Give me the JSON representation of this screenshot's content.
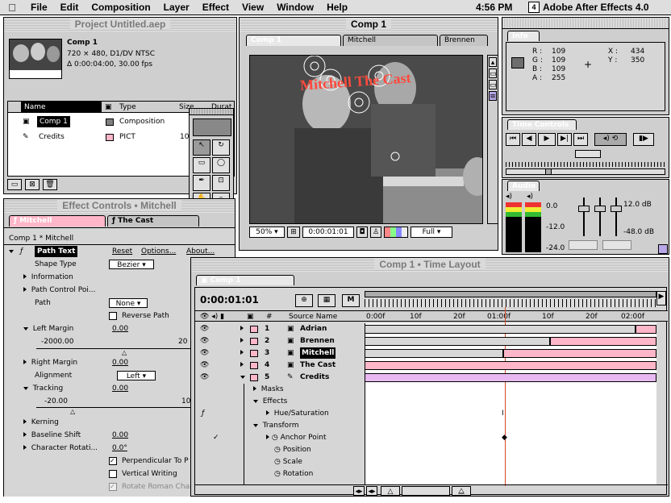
{
  "menubar": {
    "apple": "",
    "items": [
      "File",
      "Edit",
      "Composition",
      "Layer",
      "Effect",
      "View",
      "Window",
      "Help"
    ],
    "clock": "4:56 PM",
    "app_icon_label": "4",
    "app_name": "Adobe After Effects 4.0"
  },
  "project": {
    "title": "Project Untitled.aep",
    "comp_name": "Comp 1",
    "comp_line1": "720 × 480, D1/DV NTSC",
    "comp_line2": "Δ 0:00:04:00, 30.00 fps",
    "columns": [
      "Name",
      "Type",
      "Size",
      "Durat"
    ],
    "items": [
      {
        "name": "Comp 1",
        "type": "Composition",
        "color": "#808080",
        "size": ""
      },
      {
        "name": "Credits",
        "type": "PICT",
        "color": "#ffb6c8",
        "size": "10"
      }
    ]
  },
  "composition": {
    "title": "Comp 1",
    "tabs": [
      "Comp 1",
      "Mitchell",
      "Brennen"
    ],
    "overlay_text": "Mitchell The Cast",
    "zoom": "50%",
    "timecode": "0:00:01:01",
    "resolution": "Full"
  },
  "info": {
    "tab": "Info",
    "r_label": "R :",
    "r": "109",
    "g_label": "G :",
    "g": "109",
    "b_label": "B :",
    "b": "109",
    "a_label": "A :",
    "a": "255",
    "x_label": "X :",
    "x": "434",
    "y_label": "Y :",
    "y": "350",
    "swatch_color": "#6d6d6d"
  },
  "time_controls": {
    "tab": "Time Controls"
  },
  "audio": {
    "tab": "Audio",
    "levels": [
      "0.0",
      "-12.0",
      "-24.0"
    ],
    "right_levels": [
      "12.0 dB",
      "-48.0 dB"
    ]
  },
  "effect_controls": {
    "title": "Effect Controls • Mitchell",
    "tabs": [
      "Mitchell",
      "The Cast"
    ],
    "breadcrumb": "Comp 1 * Mitchell",
    "effect_name": "Path Text",
    "reset": "Reset",
    "options": "Options...",
    "about": "About...",
    "props": [
      {
        "label": "Shape Type",
        "value": "Bezier"
      },
      {
        "label": "Information",
        "value": ""
      },
      {
        "label": "Path Control Poi...",
        "value": ""
      },
      {
        "label": "Path",
        "value": "None"
      },
      {
        "label": "Reverse Path",
        "value": ""
      },
      {
        "label": "Left Margin",
        "value": "0.00"
      },
      {
        "label": "-2000.00",
        "value": "20"
      },
      {
        "label": "Right Margin",
        "value": "0.00"
      },
      {
        "label": "Alignment",
        "value": "Left"
      },
      {
        "label": "Tracking",
        "value": "0.00"
      },
      {
        "label": "-20.00",
        "value": "10"
      },
      {
        "label": "Kerning",
        "value": ""
      },
      {
        "label": "Baseline Shift",
        "value": "0.00"
      },
      {
        "label": "Character Rotati...",
        "value": "0.0°"
      },
      {
        "label": "Perpendicular To P",
        "value": ""
      },
      {
        "label": "Vertical Writing",
        "value": ""
      },
      {
        "label": "Rotate Roman Char",
        "value": ""
      }
    ]
  },
  "timeline": {
    "title": "Comp 1 • Time Layout",
    "tab": "Comp 1",
    "timecode": "0:00:01:01",
    "ruler": [
      "0:00f",
      "10f",
      "20f",
      "01:00f",
      "10f",
      "20f",
      "02:00f"
    ],
    "source_header": "Source Name",
    "num_header": "#",
    "layers": [
      {
        "num": "1",
        "name": "Adrian"
      },
      {
        "num": "2",
        "name": "Brennen"
      },
      {
        "num": "3",
        "name": "Mitchell"
      },
      {
        "num": "4",
        "name": "The Cast"
      },
      {
        "num": "5",
        "name": "Credits"
      }
    ],
    "sub": [
      {
        "label": "Masks"
      },
      {
        "label": "Effects"
      },
      {
        "label": "Hue/Saturation"
      },
      {
        "label": "Transform"
      },
      {
        "label": "Anchor Point"
      },
      {
        "label": "Position"
      },
      {
        "label": "Scale"
      },
      {
        "label": "Rotation"
      }
    ]
  }
}
